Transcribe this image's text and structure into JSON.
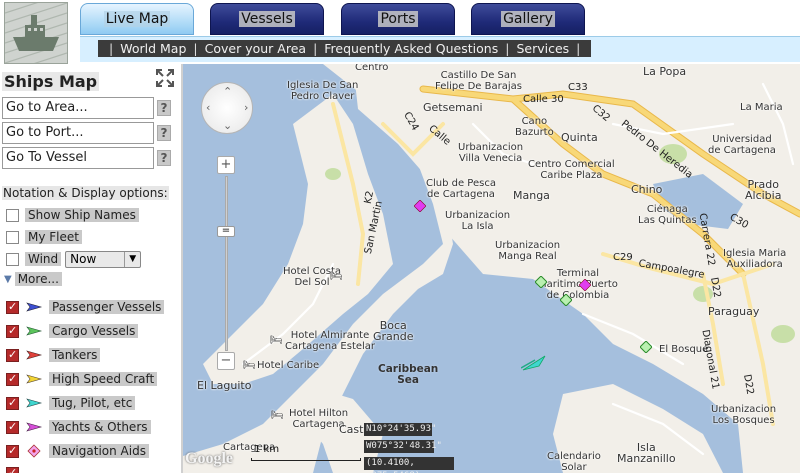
{
  "header": {
    "logo_icon": "ship-logo-icon",
    "tabs": [
      {
        "label": "Live Map",
        "active": true
      },
      {
        "label": "Vessels",
        "active": false
      },
      {
        "label": "Ports",
        "active": false
      },
      {
        "label": "Gallery",
        "active": false
      }
    ],
    "nav_links": [
      "World Map",
      "Cover your Area",
      "Frequently Asked Questions",
      "Services"
    ],
    "nav_separator": "|"
  },
  "sidebar": {
    "title": "Ships Map",
    "goto_area": "Go to Area...",
    "goto_port": "Go to Port...",
    "goto_vessel": "Go To Vessel",
    "help_glyph": "?",
    "notation_label": "Notation & Display options:",
    "show_ship_names": "Show Ship Names",
    "my_fleet": "My Fleet",
    "wind": "Wind",
    "wind_value": "Now",
    "more": "More...",
    "layers": [
      {
        "label": "Passenger Vessels",
        "color": "#3d4fd1"
      },
      {
        "label": "Cargo Vessels",
        "color": "#5cc45c"
      },
      {
        "label": "Tankers",
        "color": "#e0413b"
      },
      {
        "label": "High Speed Craft",
        "color": "#f2d535"
      },
      {
        "label": "Tug, Pilot, etc",
        "color": "#3fd6cf"
      },
      {
        "label": "Yachts & Others",
        "color": "#d54fd8"
      },
      {
        "label": "Navigation Aids",
        "color": "#e06ad9"
      }
    ]
  },
  "map": {
    "labels": {
      "centro": "Centro",
      "la_popa": "La Popa",
      "iglesia_san_pedro": "Iglesia De San\nPedro Claver",
      "castillo": "Castillo De San\nFelipe De Barajas",
      "getsemani": "Getsemani",
      "cano_bazurto": "Cano\nBazurto",
      "quinta": "Quinta",
      "villa_venecia": "Urbanizacion\nVilla Venecia",
      "centro_comercial": "Centro Comercial\nCaribe Plaza",
      "club_pesca": "Club de Pesca\nde Cartagena",
      "manga": "Manga",
      "chino": "Chino",
      "la_maria": "La Maria",
      "universidad": "Universidad\nde Cartagena",
      "prado": "Prado\nAlcibia",
      "cienaga": "Ciénaga\nLas Quintas",
      "urb_la_isla": "Urbanizacion\nLa Isla",
      "manga_real": "Urbanizacion\nManga Real",
      "iglesia_maria": "Iglesia Maria\nAuxiliadora",
      "hotel_costa": "Hotel Costa\nDel Sol",
      "terminal": "Terminal\nMaritimo Puerto\nde Colombia",
      "paraguay": "Paraguay",
      "boca_grande": "Boca\nGrande",
      "hotel_almirante": "Hotel Almirante\nCartagena Estelar",
      "hotel_caribe": "Hotel Caribe",
      "caribbean_sea": "Caribbean\nSea",
      "el_bosque": "El Bosque",
      "el_laguito": "El Laguito",
      "hotel_hilton": "Hotel Hilton\nCartagena",
      "castillo_short": "Cast",
      "urb_bosque": "Urbanizacion\nLos Bosques",
      "cartagena": "Cartagena",
      "isla_manzanillo": "Isla\nManzanillo",
      "calendario_solar": "Calendario\nSolar"
    },
    "roads": [
      "Calle 30",
      "C33",
      "C32",
      "C24",
      "Calle",
      "Pedro De Heredia",
      "C30",
      "C29",
      "Campoalegre",
      "Carrera 22",
      "D22",
      "Diagonal 21",
      "D22",
      "San Martin",
      "K2",
      "Calle 30"
    ],
    "coords": {
      "lat": "N10°24'35.93\"",
      "lon": "W075°32'48.31\"",
      "decimal": "(10.4100, -075.5468)"
    },
    "scale_label": "1 km",
    "google_logo": "Google",
    "zoom_in": "+",
    "zoom_out": "−",
    "zoom_handle": "="
  },
  "colors": {
    "water": "#a5bfdd",
    "land": "#f2efe9",
    "major_road": "#f8c95a",
    "tab_active": "#a9d8f6",
    "tab_inactive": "#1f2a78"
  }
}
